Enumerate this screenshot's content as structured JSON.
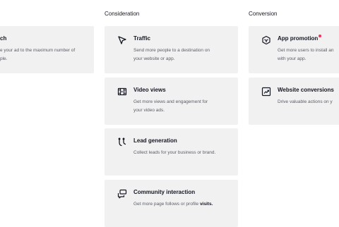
{
  "columns": {
    "consideration": "Consideration",
    "conversion": "Conversion"
  },
  "cards": {
    "reach": {
      "title": "ch",
      "desc_line1": "e your ad to the maximum number of",
      "desc_line2": "ple."
    },
    "traffic": {
      "icon": "cursor-arrow-icon",
      "title": "Traffic",
      "desc_line1": "Send more people to a destination on",
      "desc_line2": "your website or app."
    },
    "video_views": {
      "icon": "film-strip-icon",
      "title": "Video views",
      "desc_line1": "Get more views and engagement for",
      "desc_line2": "your video ads."
    },
    "lead_generation": {
      "icon": "funnel-icon",
      "title": "Lead generation",
      "desc_line1": "Collect leads for your business or brand."
    },
    "community_interaction": {
      "icon": "chat-bubbles-icon",
      "title": "Community interaction",
      "desc_prefix": "Get more page follows or profile ",
      "desc_strong": "visits."
    },
    "app_promotion": {
      "icon": "app-cube-icon",
      "title": "App promotion",
      "desc_line1": "Get more users to install an",
      "desc_line2": "with your app."
    },
    "website_conversions": {
      "icon": "trend-chart-icon",
      "title": "Website conversions",
      "desc_line1": "Drive valuable actions on y"
    }
  },
  "colors": {
    "card_bg": "#f1f1f2",
    "text_primary": "#161823",
    "text_secondary": "#5c5e66",
    "new_dot": "#fe2c55"
  }
}
